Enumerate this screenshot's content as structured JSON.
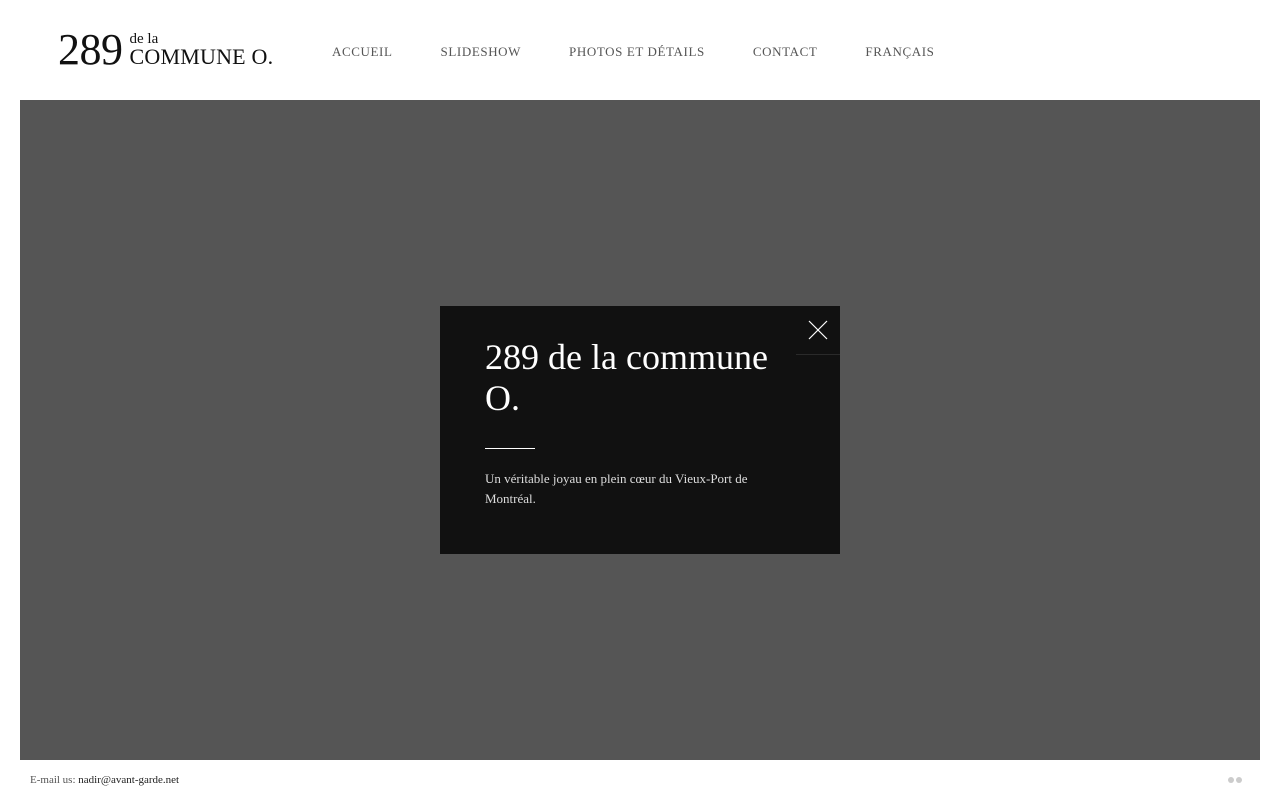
{
  "logo": {
    "number": "289",
    "small": "de la",
    "big": "COMMUNE O."
  },
  "nav": {
    "items": [
      {
        "label": "ACCUEIL"
      },
      {
        "label": "SLIDESHOW"
      },
      {
        "label": "PHOTOS ET DÉTAILS"
      },
      {
        "label": "CONTACT"
      },
      {
        "label": "FRANÇAIS"
      }
    ]
  },
  "modal": {
    "title": "289 de la commune O.",
    "text": "Un véritable joyau en plein cœur du Vieux-Port de Montréal.",
    "close_icon": "close-icon"
  },
  "footer": {
    "email_label": "E-mail us:",
    "email": "nadir@avant-garde.net",
    "icon": "flickr-icon"
  },
  "colors": {
    "stage_bg": "#555555",
    "modal_bg": "#111111",
    "nav_text": "#555555"
  }
}
